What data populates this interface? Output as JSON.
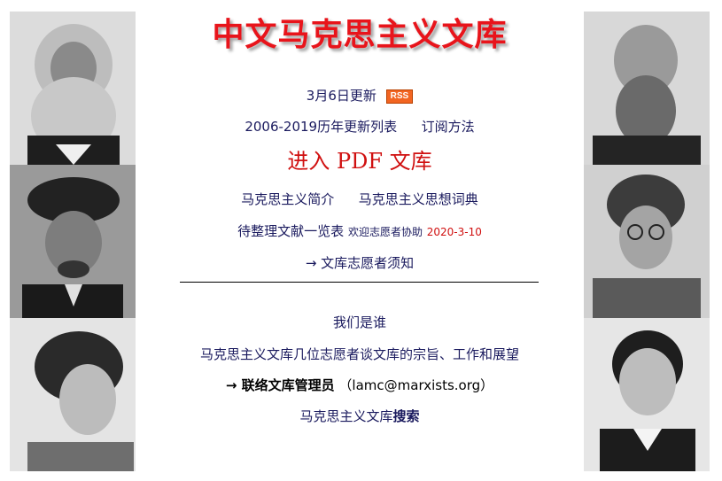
{
  "title": "中文马克思主义文库",
  "update": {
    "text": "3月6日更新",
    "rss": "RSS"
  },
  "history": {
    "list": "2006-2019历年更新列表",
    "subscribe": "订阅方法"
  },
  "pdf": "进入 PDF 文库",
  "intro": {
    "intro": "马克思主义简介",
    "dictionary": "马克思主义思想词典"
  },
  "pending": {
    "list": "待整理文献一览表",
    "welcome": "欢迎志愿者协助",
    "date": "2020-3-10"
  },
  "volunteer": "→ 文库志愿者须知",
  "who": "我们是谁",
  "talk": "马克思主义文库几位志愿者谈文库的宗旨、工作和展望",
  "contact": {
    "label": "→ 联络文库管理员",
    "open": "（",
    "email": "lamc@marxists.org",
    "close": "）"
  },
  "search": {
    "prefix": "马克思主义文库",
    "bold": "搜索"
  },
  "colors": {
    "title": "#e8141b",
    "link": "#1a1a5e",
    "rss": "#f26522",
    "date": "#d01010"
  }
}
